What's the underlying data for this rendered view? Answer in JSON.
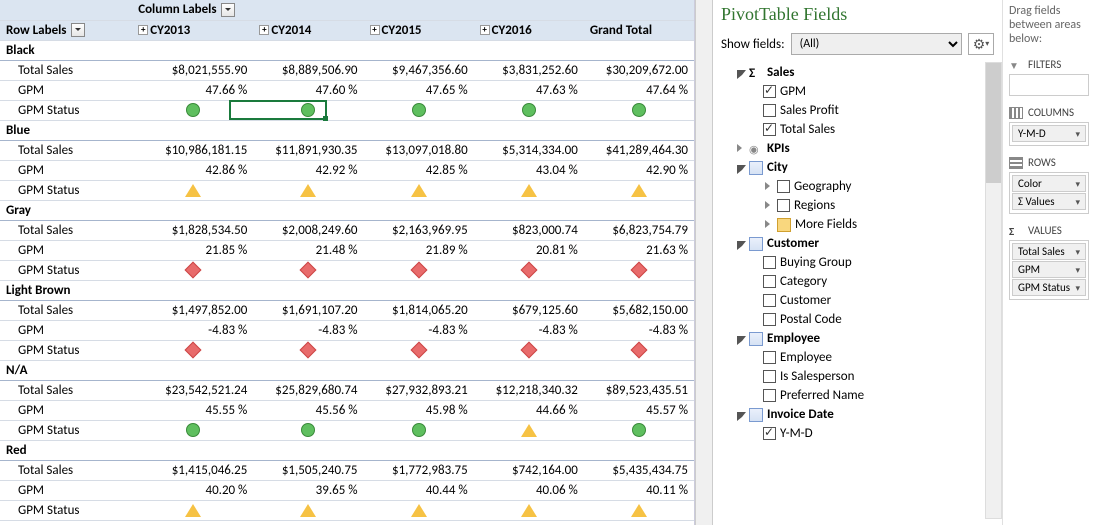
{
  "pivot": {
    "col_label_header": "Column Labels",
    "row_label_header": "Row Labels",
    "columns": [
      "CY2013",
      "CY2014",
      "CY2015",
      "CY2016",
      "Grand Total"
    ],
    "measures": [
      "Total Sales",
      "GPM",
      "GPM Status"
    ],
    "groups": [
      {
        "name": "Black",
        "total_sales": [
          "$8,021,555.90",
          "$8,889,506.90",
          "$9,467,356.60",
          "$3,831,252.60",
          "$30,209,672.00"
        ],
        "gpm": [
          "47.66 %",
          "47.60 %",
          "47.65 %",
          "47.63 %",
          "47.64 %"
        ],
        "status": [
          "green",
          "green",
          "green",
          "green",
          "green"
        ]
      },
      {
        "name": "Blue",
        "total_sales": [
          "$10,986,181.15",
          "$11,891,930.35",
          "$13,097,018.80",
          "$5,314,334.00",
          "$41,289,464.30"
        ],
        "gpm": [
          "42.86 %",
          "42.92 %",
          "42.85 %",
          "43.04 %",
          "42.90 %"
        ],
        "status": [
          "yellow",
          "yellow",
          "yellow",
          "yellow",
          "yellow"
        ]
      },
      {
        "name": "Gray",
        "total_sales": [
          "$1,828,534.50",
          "$2,008,249.60",
          "$2,163,969.95",
          "$823,000.74",
          "$6,823,754.79"
        ],
        "gpm": [
          "21.85 %",
          "21.48 %",
          "21.89 %",
          "20.81 %",
          "21.63 %"
        ],
        "status": [
          "red",
          "red",
          "red",
          "red",
          "red"
        ]
      },
      {
        "name": "Light Brown",
        "total_sales": [
          "$1,497,852.00",
          "$1,691,107.20",
          "$1,814,065.20",
          "$679,125.60",
          "$5,682,150.00"
        ],
        "gpm": [
          "-4.83 %",
          "-4.83 %",
          "-4.83 %",
          "-4.83 %",
          "-4.83 %"
        ],
        "status": [
          "red",
          "red",
          "red",
          "red",
          "red"
        ]
      },
      {
        "name": "N/A",
        "total_sales": [
          "$23,542,521.24",
          "$25,829,680.74",
          "$27,932,893.21",
          "$12,218,340.32",
          "$89,523,435.51"
        ],
        "gpm": [
          "45.55 %",
          "45.56 %",
          "45.98 %",
          "44.66 %",
          "45.57 %"
        ],
        "status": [
          "green",
          "green",
          "green",
          "yellow",
          "green"
        ]
      },
      {
        "name": "Red",
        "total_sales": [
          "$1,415,046.25",
          "$1,505,240.75",
          "$1,772,983.75",
          "$742,164.00",
          "$5,435,434.75"
        ],
        "gpm": [
          "40.20 %",
          "39.65 %",
          "40.44 %",
          "40.06 %",
          "40.11 %"
        ],
        "status": [
          "yellow",
          "yellow",
          "yellow",
          "yellow",
          "yellow"
        ]
      }
    ]
  },
  "panel": {
    "title": "PivotTable Fields",
    "show_label": "Show fields:",
    "show_value": "(All)",
    "drag_hint": "Drag fields between areas below:",
    "tree": [
      {
        "type": "group",
        "icon": "sigma",
        "label": "Sales",
        "expanded": true,
        "children": [
          {
            "type": "check",
            "label": "GPM",
            "checked": true
          },
          {
            "type": "check",
            "label": "Sales Profit",
            "checked": false
          },
          {
            "type": "check",
            "label": "Total Sales",
            "checked": true
          }
        ]
      },
      {
        "type": "group",
        "icon": "kpi",
        "label": "KPIs",
        "expanded": false
      },
      {
        "type": "table",
        "label": "City",
        "expanded": true,
        "children": [
          {
            "type": "sub",
            "label": "Geography"
          },
          {
            "type": "sub",
            "label": "Regions"
          },
          {
            "type": "more",
            "label": "More Fields"
          }
        ]
      },
      {
        "type": "table",
        "label": "Customer",
        "expanded": true,
        "children": [
          {
            "type": "check",
            "label": "Buying Group",
            "checked": false
          },
          {
            "type": "check",
            "label": "Category",
            "checked": false
          },
          {
            "type": "check",
            "label": "Customer",
            "checked": false
          },
          {
            "type": "check",
            "label": "Postal Code",
            "checked": false
          }
        ]
      },
      {
        "type": "table",
        "label": "Employee",
        "expanded": true,
        "children": [
          {
            "type": "check",
            "label": "Employee",
            "checked": false
          },
          {
            "type": "check",
            "label": "Is Salesperson",
            "checked": false
          },
          {
            "type": "check",
            "label": "Preferred Name",
            "checked": false
          }
        ]
      },
      {
        "type": "table",
        "label": "Invoice Date",
        "expanded": true,
        "children": [
          {
            "type": "check",
            "label": "Y-M-D",
            "checked": true
          }
        ]
      }
    ],
    "areas": {
      "filters": {
        "label": "FILTERS",
        "items": []
      },
      "columns": {
        "label": "COLUMNS",
        "items": [
          "Y-M-D"
        ]
      },
      "rows": {
        "label": "ROWS",
        "items": [
          "Color",
          "Σ Values"
        ]
      },
      "values": {
        "label": "VALUES",
        "items": [
          "Total Sales",
          "GPM",
          "GPM Status"
        ]
      }
    }
  }
}
